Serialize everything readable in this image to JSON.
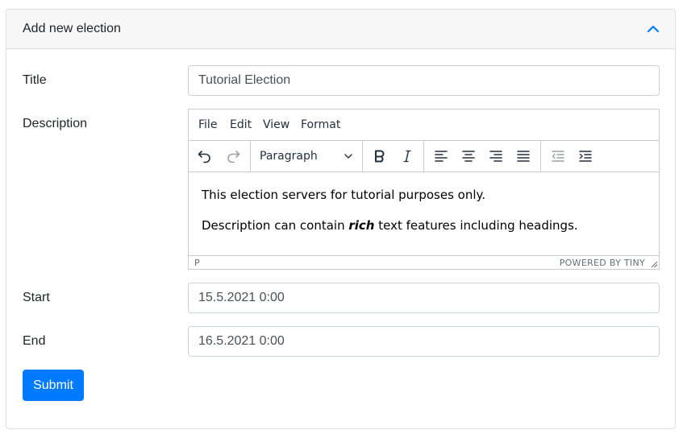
{
  "card": {
    "title": "Add new election",
    "toggle_icon": "chevron-up-icon",
    "accent_color": "#007bff"
  },
  "form": {
    "title_label": "Title",
    "title_value": "Tutorial Election",
    "description_label": "Description",
    "start_label": "Start",
    "start_value": "15.5.2021 0:00",
    "end_label": "End",
    "end_value": "16.5.2021 0:00",
    "submit_label": "Submit"
  },
  "editor": {
    "menu": [
      "File",
      "Edit",
      "View",
      "Format"
    ],
    "toolbar": {
      "undo_icon": "undo-icon",
      "redo_icon": "redo-icon",
      "block_format": "Paragraph",
      "bold_icon": "bold-icon",
      "italic_icon": "italic-icon",
      "align_left_icon": "align-left-icon",
      "align_center_icon": "align-center-icon",
      "align_right_icon": "align-right-icon",
      "align_justify_icon": "align-justify-icon",
      "outdent_icon": "outdent-icon",
      "indent_icon": "indent-icon"
    },
    "content": {
      "paragraph1": "This election servers for tutorial purposes only.",
      "paragraph2_before": "Description can contain ",
      "paragraph2_emphasis": "rich",
      "paragraph2_after": " text features including headings."
    },
    "status": {
      "path": "P",
      "branding": "Powered by Tiny"
    }
  }
}
